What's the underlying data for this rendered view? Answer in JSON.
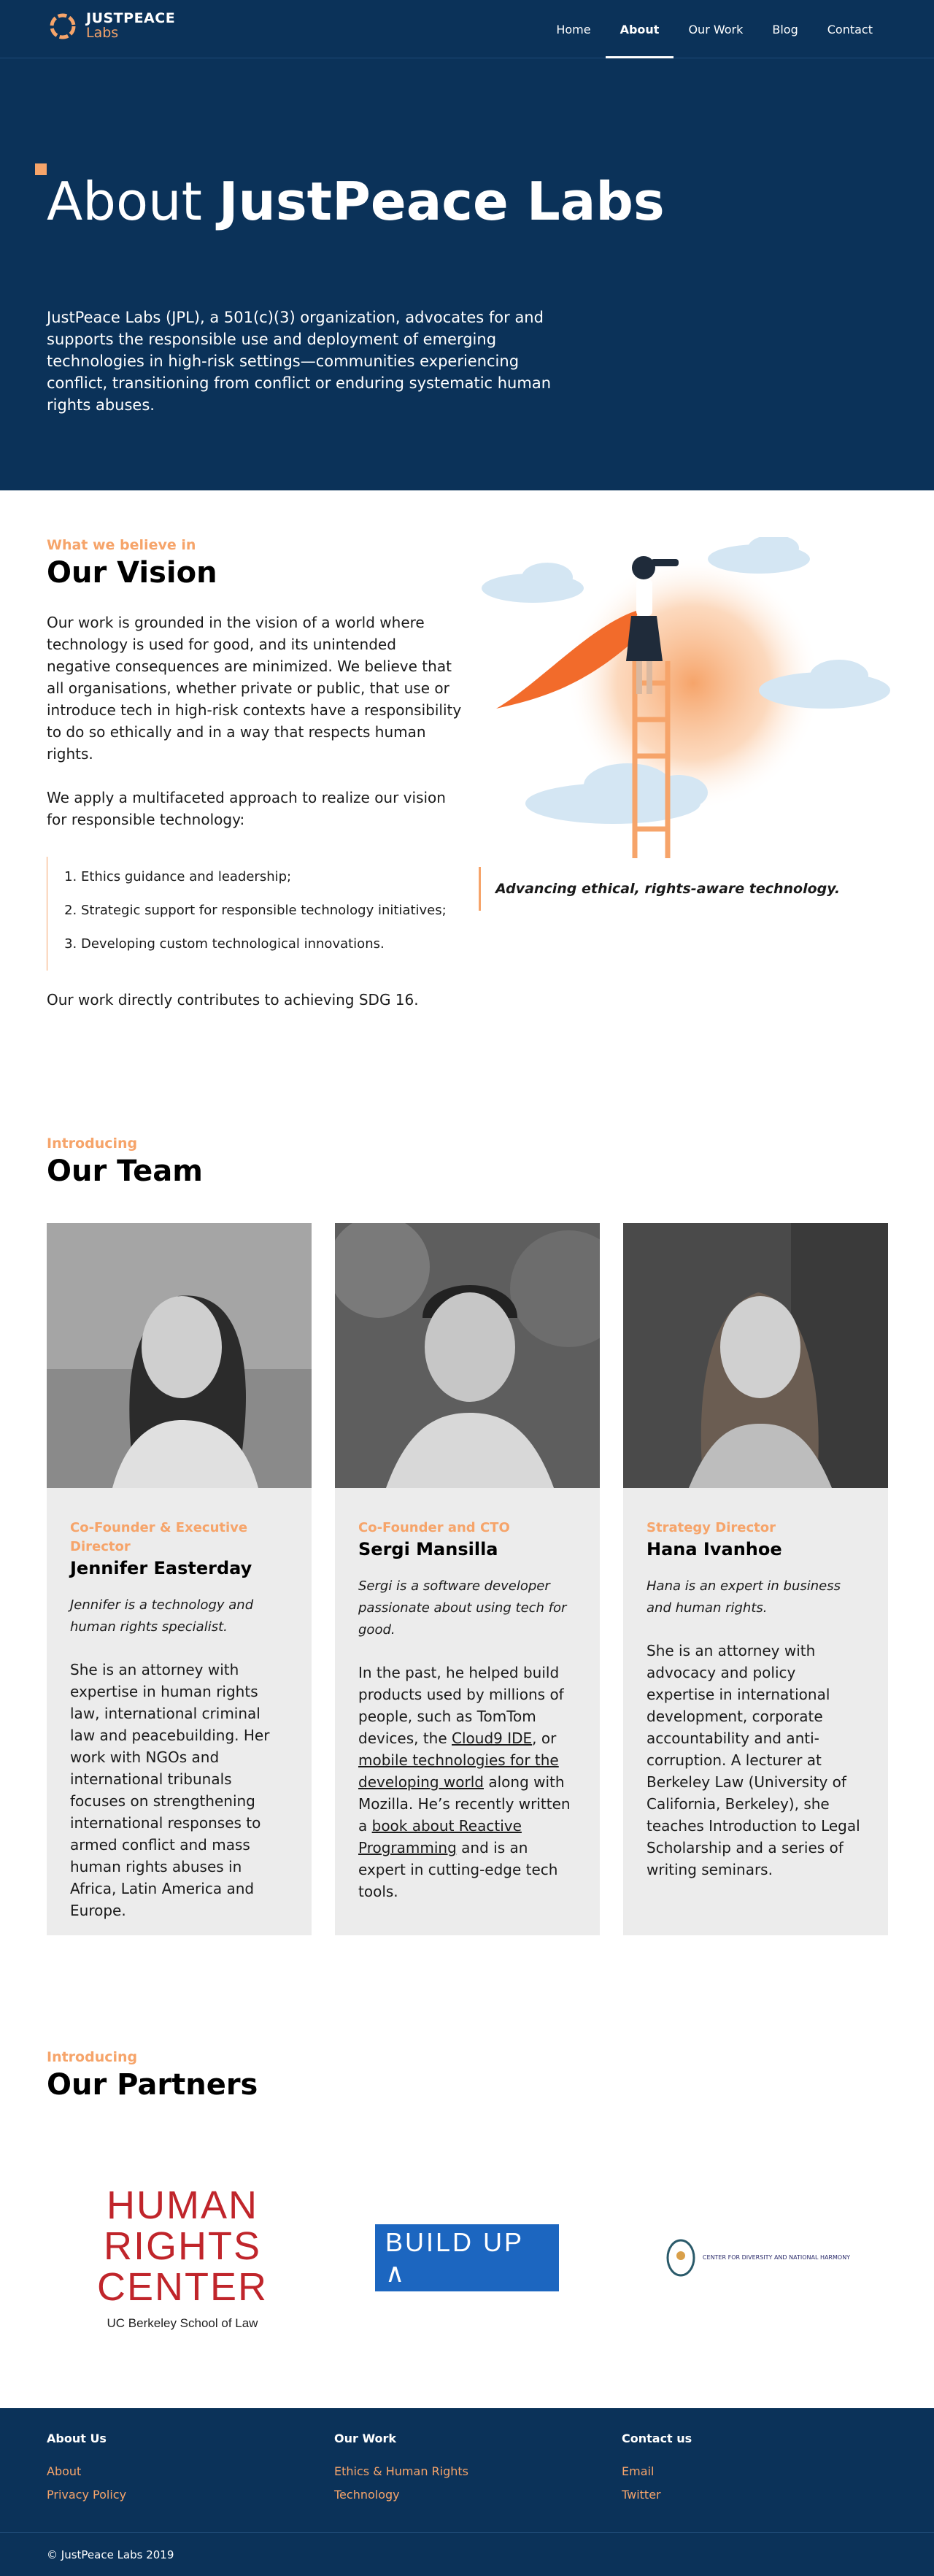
{
  "nav": {
    "brand": "JUSTPEACE",
    "brand_sub": "Labs",
    "links": [
      "Home",
      "About",
      "Our Work",
      "Blog",
      "Contact"
    ],
    "active": "About"
  },
  "hero": {
    "title_light": "About",
    "title_bold": "JustPeace Labs",
    "description": "JustPeace Labs (JPL), a 501(c)(3) organization, advocates for and supports the responsible use and deployment of emerging technologies in high-risk settings—communities experiencing conflict, transitioning from conflict or enduring systematic human rights abuses."
  },
  "vision": {
    "eyebrow": "What we believe in",
    "heading": "Our Vision",
    "p1": "Our work is grounded in the vision of a world where technology is used for good, and its unintended negative consequences are minimized. We believe that all organisations, whether private or public, that use or introduce tech in high-risk contexts have a responsibility to do so ethically and in a way that respects human rights.",
    "p2": "We apply a multifaceted approach to realize our vision for responsible technology:",
    "list": [
      "Ethics guidance and leadership;",
      "Strategic support for responsible technology initiatives;",
      "Developing custom technological innovations."
    ],
    "footer": "Our work directly contributes to achieving SDG 16.",
    "quote": "Advancing ethical, rights-aware technology."
  },
  "team": {
    "eyebrow": "Introducing",
    "heading": "Our Team",
    "members": [
      {
        "role": "Co-Founder & Executive Director",
        "name": "Jennifer Easterday",
        "intro": "Jennifer is a technology and human rights specialist.",
        "bio": "She is an attorney with expertise in human rights law, international criminal law  and peacebuilding. Her work with NGOs and international tribunals focuses on strengthening international responses to armed conflict and mass human rights abuses in Africa, Latin America and Europe."
      },
      {
        "role": "Co-Founder and CTO",
        "name": "Sergi Mansilla",
        "intro": "Sergi is a software developer passionate about using tech for good.",
        "bio_parts": [
          "In the past, he helped build products used by millions of people, such as TomTom devices, the ",
          "Cloud9 IDE",
          ", or ",
          "mobile technologies for the developing world",
          " along with Mozilla. He’s recently written a ",
          "book about Reactive Programming",
          " and is an expert in cutting-edge tech tools."
        ]
      },
      {
        "role": "Strategy Director",
        "name": "Hana Ivanhoe",
        "intro": "Hana is an expert in business and human rights.",
        "bio": "She is an attorney with advocacy and policy expertise in international development, corporate accountability and anti-corruption. A lecturer at Berkeley Law (University of California, Berkeley), she teaches Introduction to Legal Scholarship and a series of writing seminars."
      }
    ]
  },
  "partners": {
    "eyebrow": "Introducing",
    "heading": "Our Partners",
    "hrc_lines": [
      "HUMAN",
      "RIGHTS",
      "CENTER"
    ],
    "hrc_sub": "UC Berkeley School of Law",
    "buildup": "BUILD UP",
    "cdnh": "CENTER FOR DIVERSITY AND NATIONAL HARMONY"
  },
  "footer": {
    "col1": {
      "title": "About Us",
      "links": [
        "About",
        "Privacy Policy"
      ]
    },
    "col2": {
      "title": "Our Work",
      "links": [
        "Ethics & Human Rights",
        "Technology"
      ]
    },
    "col3": {
      "title": "Contact us",
      "links": [
        "Email",
        "Twitter"
      ]
    },
    "copyright": "© JustPeace Labs 2019"
  },
  "colors": {
    "navy": "#0b3259",
    "accent": "#f6a46a",
    "card": "#ececec"
  }
}
